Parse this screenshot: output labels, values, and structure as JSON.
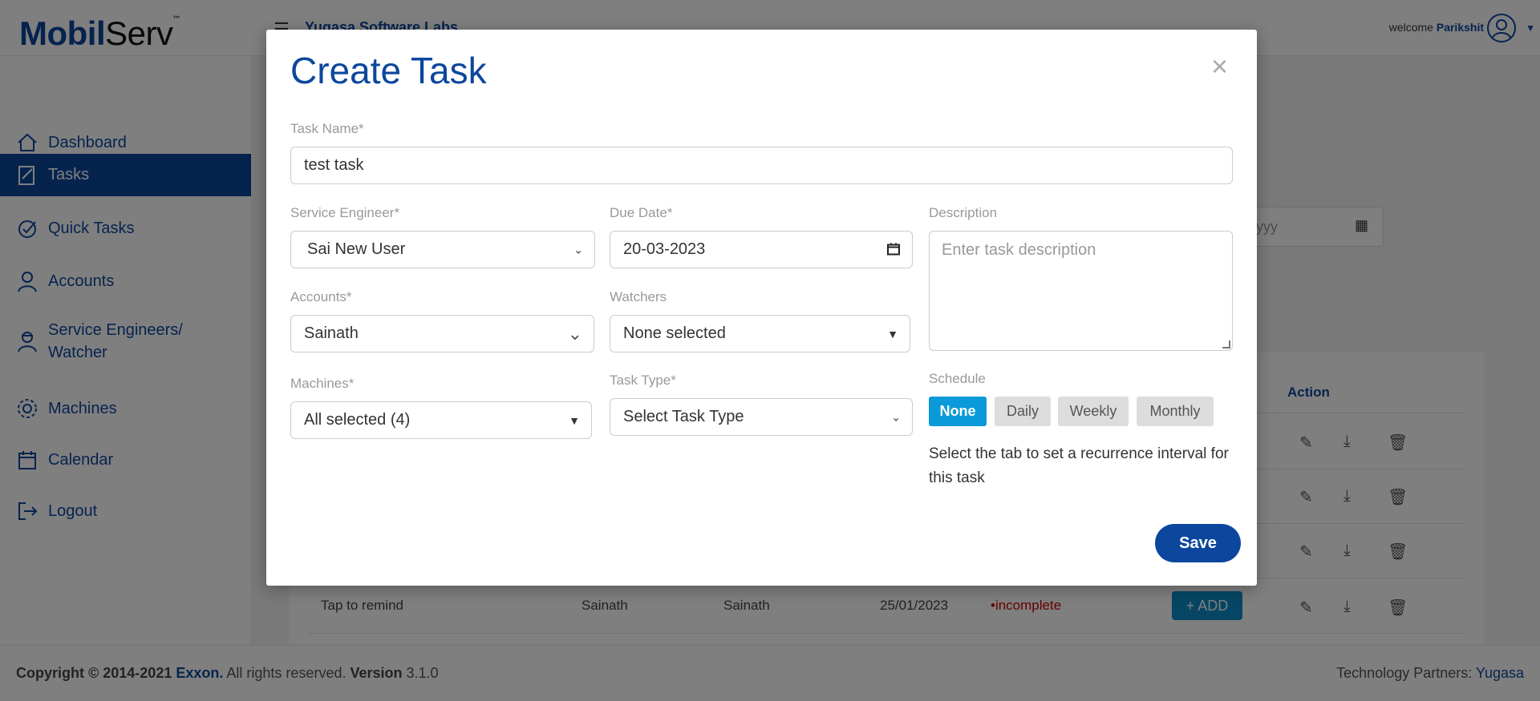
{
  "header": {
    "logo_mobil": "Mobil",
    "logo_serv": "Serv",
    "logo_tm": "™",
    "company": "Yugasa Software Labs",
    "welcome_prefix": "welcome",
    "username": "Parikshit"
  },
  "sidebar": {
    "items": [
      {
        "label": "Dashboard",
        "icon": "home-icon"
      },
      {
        "label": "Tasks",
        "icon": "tasks-icon"
      },
      {
        "label": "Quick Tasks",
        "icon": "quick-tasks-icon"
      },
      {
        "label": "Accounts",
        "icon": "user-icon"
      },
      {
        "label": "Service Engineers/\nWatcher",
        "icon": "engineer-icon"
      },
      {
        "label": "Machines",
        "icon": "gear-icon"
      },
      {
        "label": "Calendar",
        "icon": "calendar-icon"
      },
      {
        "label": "Logout",
        "icon": "logout-icon"
      }
    ],
    "active_index": 1
  },
  "background": {
    "date_placeholder": "-yyyy",
    "action_header": "Action",
    "last_row": {
      "task": "Tap to remind",
      "engineer": "Sainath",
      "account": "Sainath",
      "date": "25/01/2023",
      "status": "•incomplete",
      "add_label": "+ ADD"
    }
  },
  "modal": {
    "title": "Create Task",
    "close": "×",
    "task_name_label": "Task Name*",
    "task_name_value": "test task",
    "engineer_label": "Service Engineer*",
    "engineer_value": "Sai New User",
    "due_date_label": "Due Date*",
    "due_date_value": "20-03-2023",
    "description_label": "Description",
    "description_placeholder": "Enter task description",
    "accounts_label": "Accounts*",
    "accounts_value": "Sainath",
    "watchers_label": "Watchers",
    "watchers_value": "None selected",
    "machines_label": "Machines*",
    "machines_value": "All selected (4)",
    "task_type_label": "Task Type*",
    "task_type_value": "Select Task Type",
    "schedule_label": "Schedule",
    "schedule_options": [
      "None",
      "Daily",
      "Weekly",
      "Monthly"
    ],
    "schedule_active": "None",
    "schedule_help": "Select the tab to set a recurrence interval for this task",
    "save_label": "Save"
  },
  "footer": {
    "copyright_prefix": "Copyright © 2014-2021",
    "company": "Exxon.",
    "rights": "All rights reserved.",
    "version_label": "Version",
    "version": "3.1.0",
    "partners_label": "Technology Partners:",
    "partner": "Yugasa"
  },
  "colors": {
    "brand": "#0c479d",
    "schedule_active": "#0b9ad9",
    "status_incomplete": "#cc0000"
  }
}
